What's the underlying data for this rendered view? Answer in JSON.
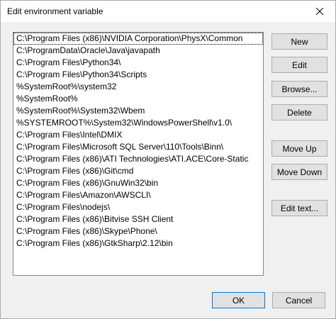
{
  "window": {
    "title": "Edit environment variable"
  },
  "list": {
    "items": [
      "C:\\Program Files (x86)\\NVIDIA Corporation\\PhysX\\Common",
      "C:\\ProgramData\\Oracle\\Java\\javapath",
      "C:\\Program Files\\Python34\\",
      "C:\\Program Files\\Python34\\Scripts",
      "%SystemRoot%\\system32",
      "%SystemRoot%",
      "%SystemRoot%\\System32\\Wbem",
      "%SYSTEMROOT%\\System32\\WindowsPowerShell\\v1.0\\",
      "C:\\Program Files\\Intel\\DMIX",
      "C:\\Program Files\\Microsoft SQL Server\\110\\Tools\\Binn\\",
      "C:\\Program Files (x86)\\ATI Technologies\\ATI.ACE\\Core-Static",
      "C:\\Program Files (x86)\\Git\\cmd",
      "C:\\Program Files (x86)\\GnuWin32\\bin",
      "C:\\Program Files\\Amazon\\AWSCLI\\",
      "C:\\Program Files\\nodejs\\",
      "C:\\Program Files (x86)\\Bitvise SSH Client",
      "C:\\Program Files (x86)\\Skype\\Phone\\",
      "C:\\Program Files (x86)\\GtkSharp\\2.12\\bin"
    ]
  },
  "buttons": {
    "new": "New",
    "edit": "Edit",
    "browse": "Browse...",
    "delete": "Delete",
    "move_up": "Move Up",
    "move_down": "Move Down",
    "edit_text": "Edit text...",
    "ok": "OK",
    "cancel": "Cancel"
  },
  "icons": {
    "close": "close-icon"
  },
  "colors": {
    "accent": "#0078d7",
    "button_face": "#e1e1e1",
    "background": "#f0f0f0"
  }
}
